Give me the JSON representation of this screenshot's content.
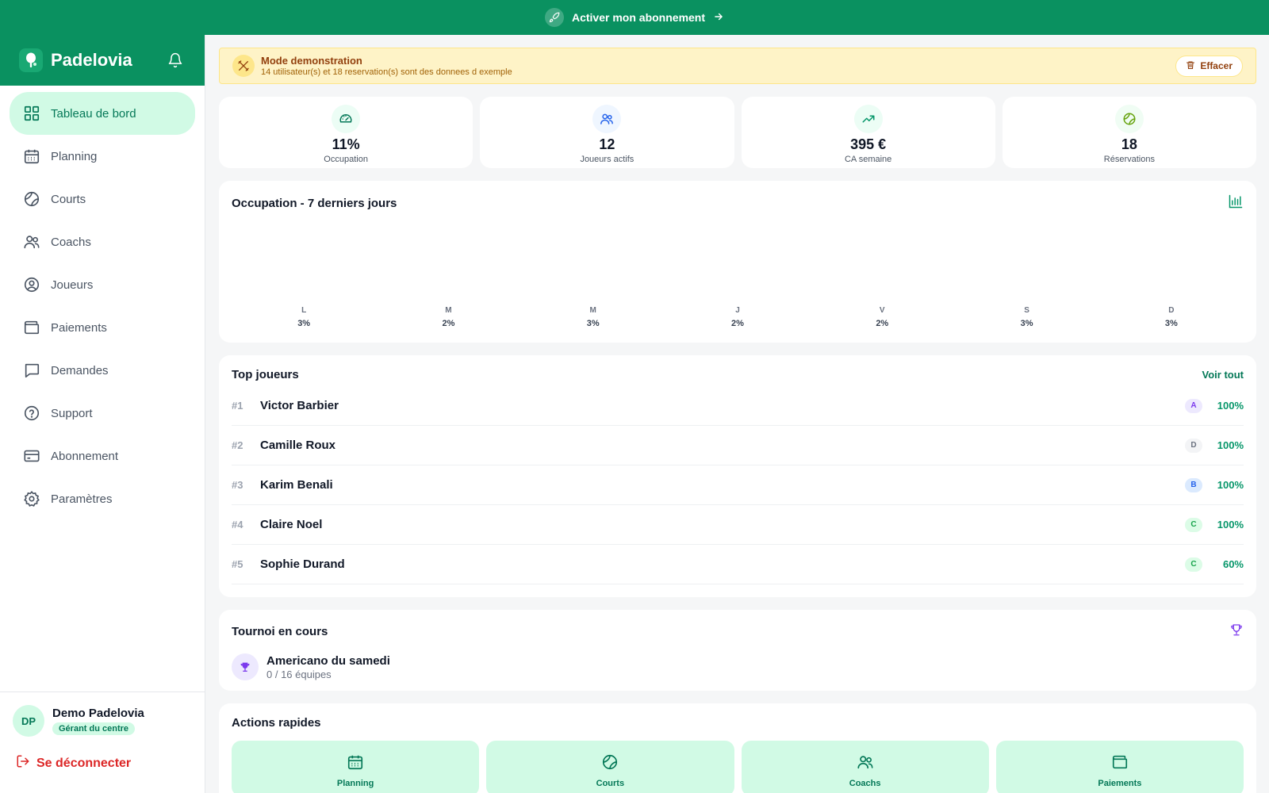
{
  "banner": {
    "label": "Activer mon abonnement"
  },
  "app": {
    "name": "Padelovia"
  },
  "sidebar": {
    "items": [
      {
        "label": "Tableau de bord",
        "icon": "dashboard-icon"
      },
      {
        "label": "Planning",
        "icon": "calendar-icon"
      },
      {
        "label": "Courts",
        "icon": "court-ball-icon"
      },
      {
        "label": "Coachs",
        "icon": "users-icon"
      },
      {
        "label": "Joueurs",
        "icon": "user-circle-icon"
      },
      {
        "label": "Paiements",
        "icon": "wallet-icon"
      },
      {
        "label": "Demandes",
        "icon": "chat-icon"
      },
      {
        "label": "Support",
        "icon": "help-icon"
      },
      {
        "label": "Abonnement",
        "icon": "credit-card-icon"
      },
      {
        "label": "Paramètres",
        "icon": "gear-icon"
      }
    ]
  },
  "user": {
    "initials": "DP",
    "name": "Demo Padelovia",
    "role": "Gérant du centre",
    "logout": "Se déconnecter"
  },
  "demo": {
    "title": "Mode demonstration",
    "subtitle": "14 utilisateur(s) et 18 reservation(s) sont des donnees d exemple",
    "clear_label": "Effacer"
  },
  "stats": [
    {
      "value": "11%",
      "label": "Occupation",
      "icon": "gauge-icon"
    },
    {
      "value": "12",
      "label": "Joueurs actifs",
      "icon": "users-icon"
    },
    {
      "value": "395 €",
      "label": "CA semaine",
      "icon": "trending-up-icon"
    },
    {
      "value": "18",
      "label": "Réservations",
      "icon": "ball-icon"
    }
  ],
  "occupancy": {
    "title": "Occupation - 7 derniers jours",
    "icon": "bar-chart-icon",
    "days": [
      {
        "letter": "L",
        "value": "3%"
      },
      {
        "letter": "M",
        "value": "2%"
      },
      {
        "letter": "M",
        "value": "3%"
      },
      {
        "letter": "J",
        "value": "2%"
      },
      {
        "letter": "V",
        "value": "2%"
      },
      {
        "letter": "S",
        "value": "3%"
      },
      {
        "letter": "D",
        "value": "3%"
      }
    ]
  },
  "top_players": {
    "title": "Top joueurs",
    "see_all": "Voir tout",
    "rows": [
      {
        "rank": "#1",
        "name": "Victor Barbier",
        "level": "A",
        "pct": "100%"
      },
      {
        "rank": "#2",
        "name": "Camille Roux",
        "level": "D",
        "pct": "100%"
      },
      {
        "rank": "#3",
        "name": "Karim Benali",
        "level": "B",
        "pct": "100%"
      },
      {
        "rank": "#4",
        "name": "Claire Noel",
        "level": "C",
        "pct": "100%"
      },
      {
        "rank": "#5",
        "name": "Sophie Durand",
        "level": "C",
        "pct": "60%"
      }
    ]
  },
  "level_colors": {
    "A": {
      "bg": "#ede9fe",
      "fg": "#7c3aed"
    },
    "B": {
      "bg": "#dbeafe",
      "fg": "#2563eb"
    },
    "C": {
      "bg": "#dcfce7",
      "fg": "#16a34a"
    },
    "D": {
      "bg": "#f3f4f6",
      "fg": "#6b7280"
    }
  },
  "tournament": {
    "title": "Tournoi en cours",
    "name": "Americano du samedi",
    "teams": "0 / 16 équipes"
  },
  "quick_actions": {
    "title": "Actions rapides",
    "items": [
      {
        "label": "Planning",
        "icon": "calendar-icon"
      },
      {
        "label": "Courts",
        "icon": "court-ball-icon"
      },
      {
        "label": "Coachs",
        "icon": "users-icon"
      },
      {
        "label": "Paiements",
        "icon": "wallet-icon"
      }
    ]
  },
  "colors": {
    "brand": "#0a9160",
    "accent_light": "#d1fae5",
    "warning_bg": "#fef3c7"
  }
}
